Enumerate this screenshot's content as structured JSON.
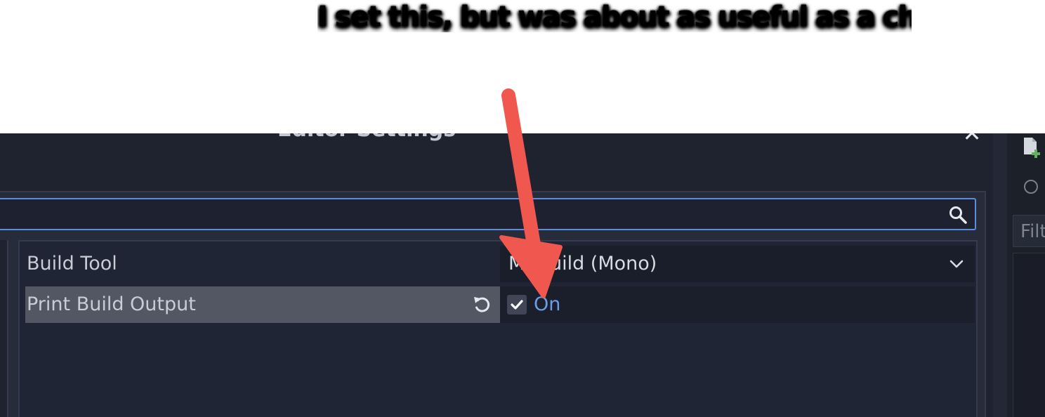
{
  "annotation": {
    "caption": "I set this, but was about as useful as a chocolate teapot"
  },
  "dialog": {
    "title": "Editor Settings",
    "search": {
      "placeholder": "",
      "value": ""
    },
    "properties": [
      {
        "name": "Build Tool",
        "value": "MSBuild (Mono)"
      },
      {
        "name": "Print Build Output",
        "checked": true,
        "value": "On"
      }
    ]
  },
  "dock": {
    "filter_placeholder": "Filt"
  },
  "colors": {
    "accent": "#5c8be0",
    "on_text": "#6a9de6",
    "arrow": "#f0574f"
  },
  "icons": [
    "close-icon",
    "search-icon",
    "chevron-down-icon",
    "revert-icon",
    "checkmark-icon",
    "new-script-icon",
    "radio-icon"
  ]
}
